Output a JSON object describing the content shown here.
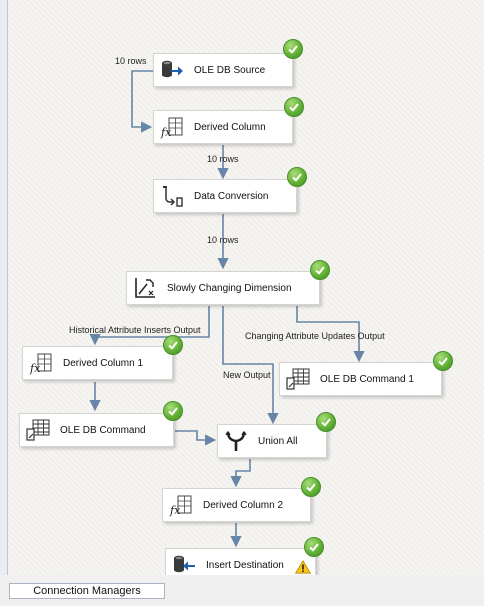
{
  "tasks": {
    "ole_db_source": {
      "label": "OLE DB Source",
      "icon": "ole-db-source-icon",
      "status": "success"
    },
    "derived_column": {
      "label": "Derived Column",
      "icon": "derived-column-icon",
      "status": "success"
    },
    "data_conversion": {
      "label": "Data Conversion",
      "icon": "data-conversion-icon",
      "status": "success"
    },
    "slowly_changing_dimension": {
      "label": "Slowly Changing Dimension",
      "icon": "slowly-changing-dimension-icon",
      "status": "success"
    },
    "derived_column_1": {
      "label": "Derived Column 1",
      "icon": "derived-column-icon",
      "status": "success"
    },
    "ole_db_command_1": {
      "label": "OLE DB Command 1",
      "icon": "ole-db-command-icon",
      "status": "success"
    },
    "ole_db_command": {
      "label": "OLE DB Command",
      "icon": "ole-db-command-icon",
      "status": "success"
    },
    "union_all": {
      "label": "Union All",
      "icon": "union-all-icon",
      "status": "success"
    },
    "derived_column_2": {
      "label": "Derived Column 2",
      "icon": "derived-column-icon",
      "status": "success"
    },
    "insert_destination": {
      "label": "Insert Destination",
      "icon": "ole-db-destination-icon",
      "status": "success",
      "warning": true
    }
  },
  "paths": {
    "source_rows": "10 rows",
    "derived_rows": "10 rows",
    "conversion_rows": "10 rows",
    "historical_output": "Historical Attribute Inserts Output",
    "changing_output": "Changing Attribute Updates Output",
    "new_output": "New Output"
  },
  "colors": {
    "success": "#62b236",
    "warning": "#f5c518",
    "connector": "#6785a7"
  },
  "footer": {
    "tab_connection_managers": "Connection Managers"
  }
}
